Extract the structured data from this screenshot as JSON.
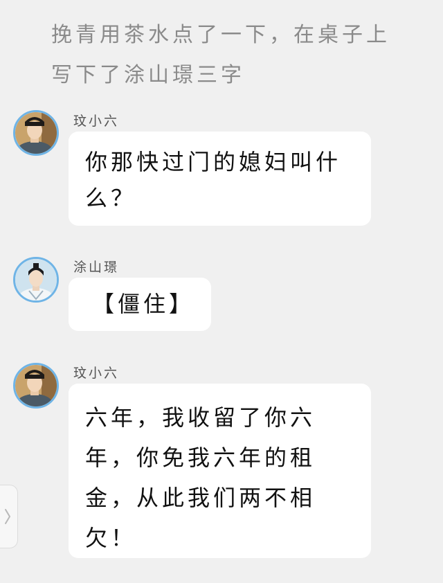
{
  "narration": "挽青用茶水点了一下，在桌子上写下了涂山璟三字",
  "messages": [
    {
      "sender": "玟小六",
      "text": "你那快过门的媳妇叫什么？"
    },
    {
      "sender": "涂山璟",
      "text": "【僵住】"
    },
    {
      "sender": "玟小六",
      "text": "六年，我收留了你六年，你免我六年的租金，从此我们两不相欠！"
    }
  ],
  "icons": {
    "side_handle": "chevron-right-icon"
  },
  "colors": {
    "background": "#f0f0f0",
    "bubble": "#ffffff",
    "avatar_ring": "#6fb4e6",
    "narration_text": "#8a8a8a"
  }
}
